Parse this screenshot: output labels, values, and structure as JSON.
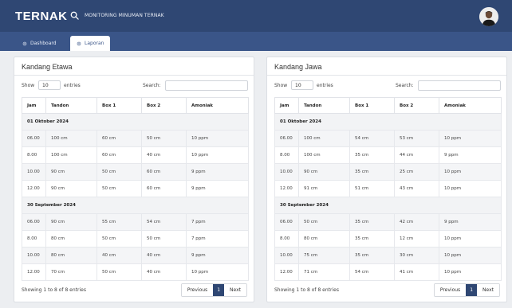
{
  "app": {
    "brand": "TERNAK",
    "search_text": "MONITORING MINUMAN TERNAK"
  },
  "nav": {
    "tabs": [
      {
        "label": "Dashboard",
        "active": false
      },
      {
        "label": "Laporan",
        "active": true
      }
    ]
  },
  "panels": [
    {
      "title": "Kandang Etawa",
      "length": {
        "show_label": "Show",
        "value": "10",
        "entries_label": "entries"
      },
      "search_label": "Search:",
      "columns": [
        "Jam",
        "Tandon",
        "Box 1",
        "Box 2",
        "Amoniak"
      ],
      "groups": [
        {
          "date": "01 Oktober 2024",
          "rows": [
            [
              "06.00",
              "100 cm",
              "60 cm",
              "50 cm",
              "10 ppm"
            ],
            [
              "8.00",
              "100 cm",
              "60 cm",
              "40 cm",
              "10 ppm"
            ],
            [
              "10.00",
              "90 cm",
              "50 cm",
              "60 cm",
              "9 ppm"
            ],
            [
              "12.00",
              "90 cm",
              "50 cm",
              "60 cm",
              "9 ppm"
            ]
          ]
        },
        {
          "date": "30 September 2024",
          "rows": [
            [
              "06.00",
              "90 cm",
              "55 cm",
              "54 cm",
              "7 ppm"
            ],
            [
              "8.00",
              "80 cm",
              "50 cm",
              "50 cm",
              "7 ppm"
            ],
            [
              "10.00",
              "80 cm",
              "40 cm",
              "40 cm",
              "9 ppm"
            ],
            [
              "12.00",
              "70 cm",
              "50 cm",
              "40 cm",
              "10 ppm"
            ]
          ]
        }
      ],
      "info": "Showing 1 to 8 of 8 entries",
      "pager": {
        "prev": "Previous",
        "page": "1",
        "next": "Next"
      }
    },
    {
      "title": "Kandang Jawa",
      "length": {
        "show_label": "Show",
        "value": "10",
        "entries_label": "entries"
      },
      "search_label": "Search:",
      "columns": [
        "Jam",
        "Tandon",
        "Box 1",
        "Box 2",
        "Amoniak"
      ],
      "groups": [
        {
          "date": "01 Oktober 2024",
          "rows": [
            [
              "06.00",
              "100 cm",
              "54 cm",
              "53 cm",
              "10 ppm"
            ],
            [
              "8.00",
              "100 cm",
              "35 cm",
              "44 cm",
              "9 ppm"
            ],
            [
              "10.00",
              "90 cm",
              "35 cm",
              "25 cm",
              "10 ppm"
            ],
            [
              "12.00",
              "91 cm",
              "51 cm",
              "43 cm",
              "10 ppm"
            ]
          ]
        },
        {
          "date": "30 September 2024",
          "rows": [
            [
              "06.00",
              "50 cm",
              "35 cm",
              "42 cm",
              "9 ppm"
            ],
            [
              "8.00",
              "80 cm",
              "35 cm",
              "12 cm",
              "10 ppm"
            ],
            [
              "10.00",
              "75 cm",
              "35 cm",
              "30 cm",
              "10 ppm"
            ],
            [
              "12.00",
              "71 cm",
              "54 cm",
              "41 cm",
              "10 ppm"
            ]
          ]
        }
      ],
      "info": "Showing 1 to 8 of 8 entries",
      "pager": {
        "prev": "Previous",
        "page": "1",
        "next": "Next"
      }
    }
  ],
  "colors": {
    "header_bg": "#2f4773",
    "nav_bg": "#3a5588",
    "page_bg": "#eceef1",
    "active_page": "#2f4773"
  },
  "icons": {
    "search": "search-icon",
    "avatar": "user-avatar",
    "dashboard": "gear-icon",
    "laporan": "gear-icon"
  }
}
